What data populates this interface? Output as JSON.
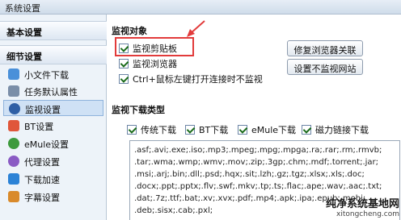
{
  "window": {
    "title": "系统设置"
  },
  "sidebar": {
    "basic_label": "基本设置",
    "detail_label": "细节设置",
    "items": [
      {
        "label": "小文件下载",
        "icon": "small-file-download-icon",
        "color": "#4a90d9",
        "selected": false
      },
      {
        "label": "任务默认属性",
        "icon": "task-properties-icon",
        "color": "#7a8ea8",
        "selected": false
      },
      {
        "label": "监视设置",
        "icon": "monitor-icon",
        "color": "#2f5fa5",
        "selected": true
      },
      {
        "label": "BT设置",
        "icon": "bt-icon",
        "color": "#e0563a",
        "selected": false
      },
      {
        "label": "eMule设置",
        "icon": "emule-icon",
        "color": "#3d9a3d",
        "selected": false
      },
      {
        "label": "代理设置",
        "icon": "proxy-icon",
        "color": "#8a5bc4",
        "selected": false
      },
      {
        "label": "下载加速",
        "icon": "accelerate-icon",
        "color": "#2b82d6",
        "selected": false
      },
      {
        "label": "字幕设置",
        "icon": "subtitle-icon",
        "color": "#d98a2b",
        "selected": false
      }
    ]
  },
  "monitor": {
    "title": "监视对象",
    "options": [
      {
        "label": "监视剪贴板",
        "checked": true
      },
      {
        "label": "监视浏览器",
        "checked": true
      },
      {
        "label": "Ctrl+鼠标左键打开连接时不监视",
        "checked": true
      }
    ],
    "repair_button": "修复浏览器关联",
    "exclude_sites_button": "设置不监视网站"
  },
  "download_types": {
    "title": "监视下载类型",
    "options": [
      {
        "label": "传统下载",
        "checked": true
      },
      {
        "label": "BT下载",
        "checked": true
      },
      {
        "label": "eMule下载",
        "checked": true
      },
      {
        "label": "磁力链接下载",
        "checked": true
      }
    ],
    "extensions_lines": [
      ".asf;.avi;.exe;.iso;.mp3;.mpeg;.mpg;.mpga;.ra;.rar;.rm;.rmvb;",
      ".tar;.wma;.wmp;.wmv;.mov;.zip;.3gp;.chm;.mdf;.torrent;.jar;",
      ".msi;.arj;.bin;.dll;.psd;.hqx;.sit;.lzh;.gz;.tgz;.xlsx;.xls;.doc;",
      ".docx;.ppt;.pptx;.flv;.swf;.mkv;.tp;.ts;.flac;.ape;.wav;.aac;.txt;",
      ".dat;.7z;.ttf;.bat;.xv;.xvx;.pdf;.mp4;.apk;.ipa;.epub;.mobi;",
      ".deb;.sisx;.cab;.pxl;"
    ]
  },
  "watermark": {
    "line1": "纯净系统基地网",
    "line2": "xitongcheng.com"
  },
  "colors": {
    "highlight": "#e23b3b"
  }
}
